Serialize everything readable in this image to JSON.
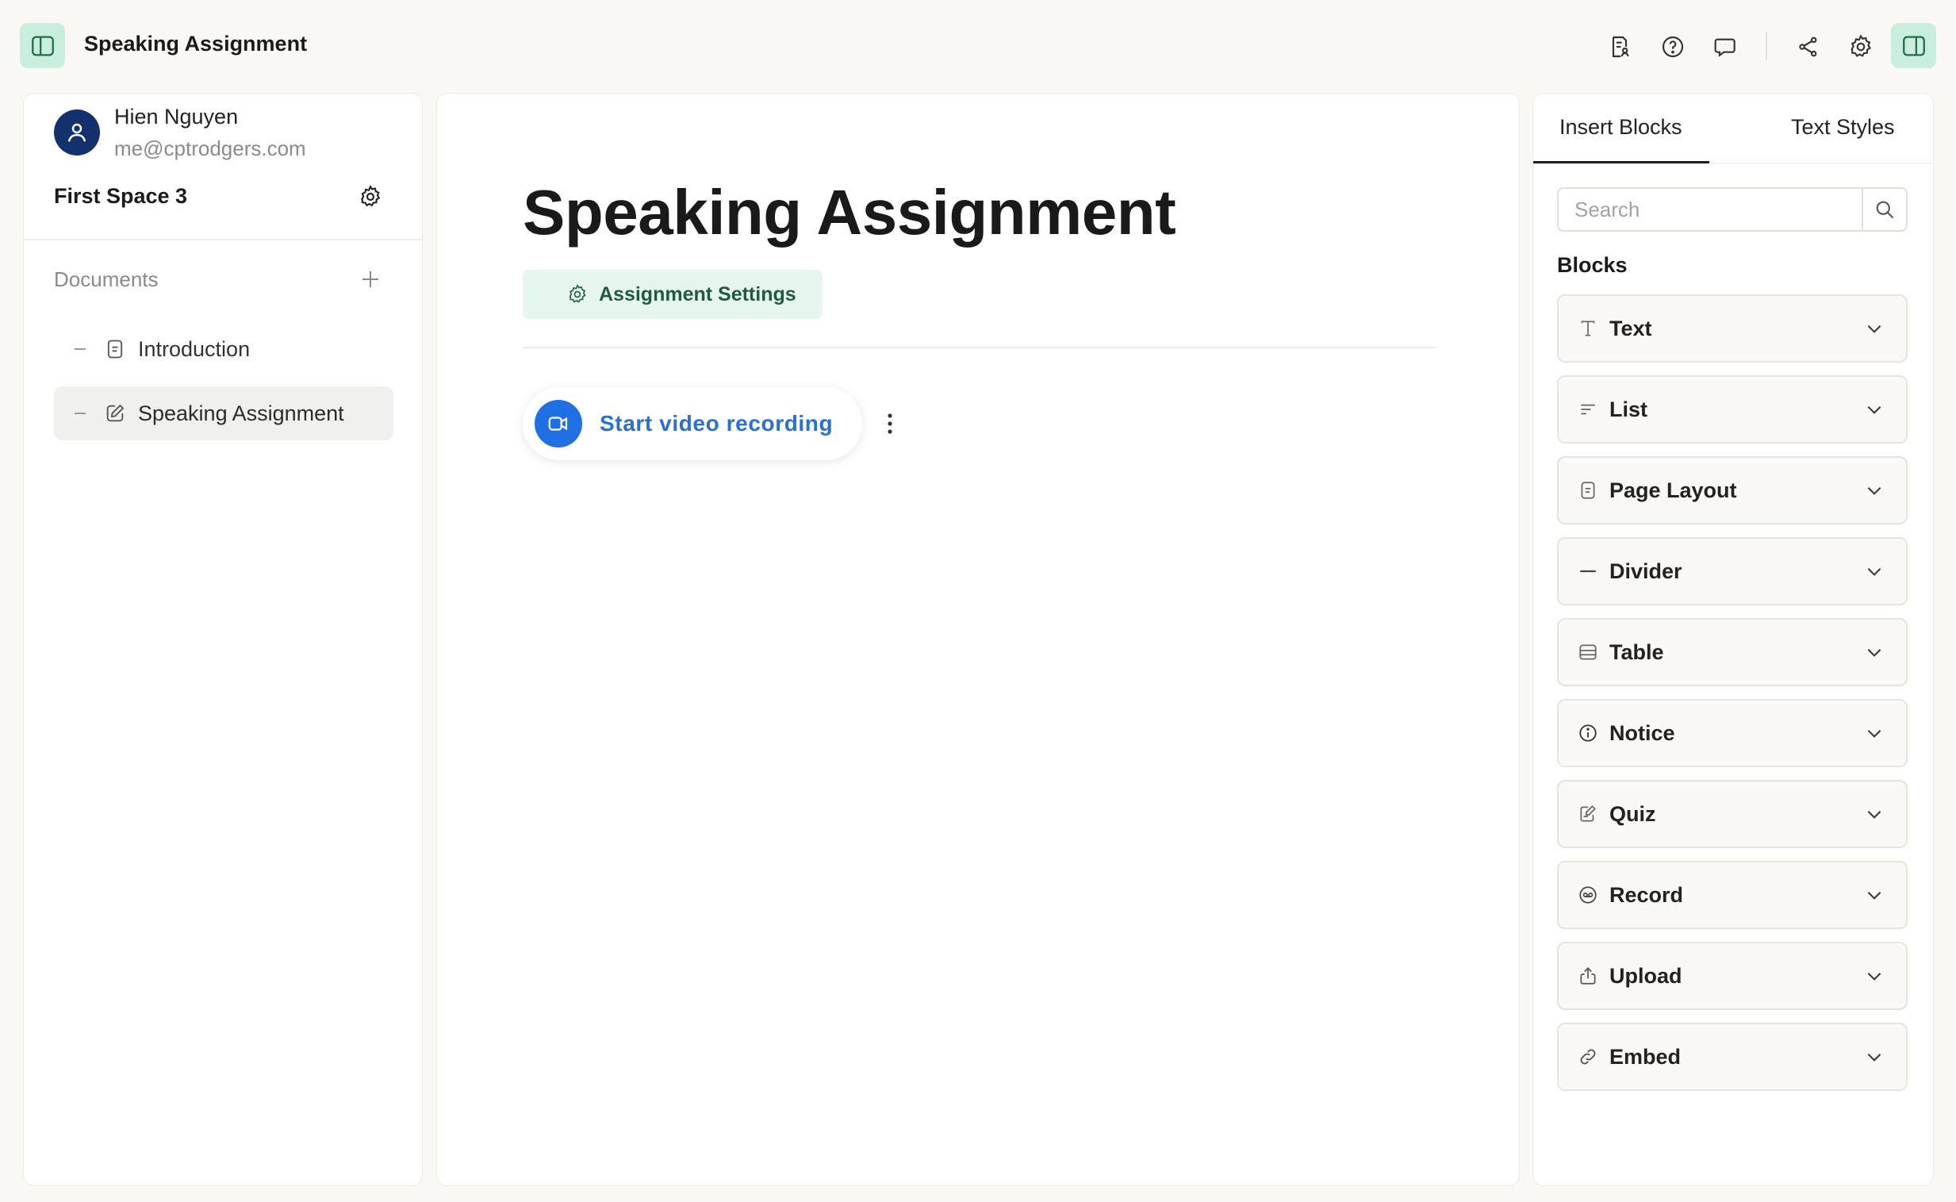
{
  "app": {
    "title": "Speaking Assignment"
  },
  "topbar": {
    "icons": [
      "document-user-icon",
      "help-icon",
      "comments-icon",
      "share-icon",
      "settings-icon",
      "right-panel-toggle-icon"
    ]
  },
  "sidebar": {
    "user": {
      "name": "Hien Nguyen",
      "email": "me@cptrodgers.com"
    },
    "space": {
      "name": "First Space 3"
    },
    "documents_label": "Documents",
    "documents": [
      {
        "label": "Introduction",
        "icon": "document-icon",
        "active": false
      },
      {
        "label": "Speaking Assignment",
        "icon": "edit-icon",
        "active": true
      }
    ]
  },
  "main": {
    "title": "Speaking Assignment",
    "settings_label": "Assignment Settings",
    "record_label": "Start video recording"
  },
  "panel": {
    "tabs": [
      {
        "label": "Insert Blocks",
        "active": true
      },
      {
        "label": "Text Styles",
        "active": false
      }
    ],
    "search": {
      "placeholder": "Search",
      "value": ""
    },
    "blocks_label": "Blocks",
    "blocks": [
      {
        "label": "Text",
        "icon": "text-icon"
      },
      {
        "label": "List",
        "icon": "list-icon"
      },
      {
        "label": "Page Layout",
        "icon": "page-layout-icon"
      },
      {
        "label": "Divider",
        "icon": "divider-icon"
      },
      {
        "label": "Table",
        "icon": "table-icon"
      },
      {
        "label": "Notice",
        "icon": "info-icon"
      },
      {
        "label": "Quiz",
        "icon": "quiz-icon"
      },
      {
        "label": "Record",
        "icon": "record-icon"
      },
      {
        "label": "Upload",
        "icon": "upload-icon"
      },
      {
        "label": "Embed",
        "icon": "link-icon"
      }
    ]
  },
  "colors": {
    "accent": "#c9eedd",
    "record_blue": "#1f6fe5",
    "settings_chip": "#e6f6ef",
    "avatar": "#13316d"
  }
}
